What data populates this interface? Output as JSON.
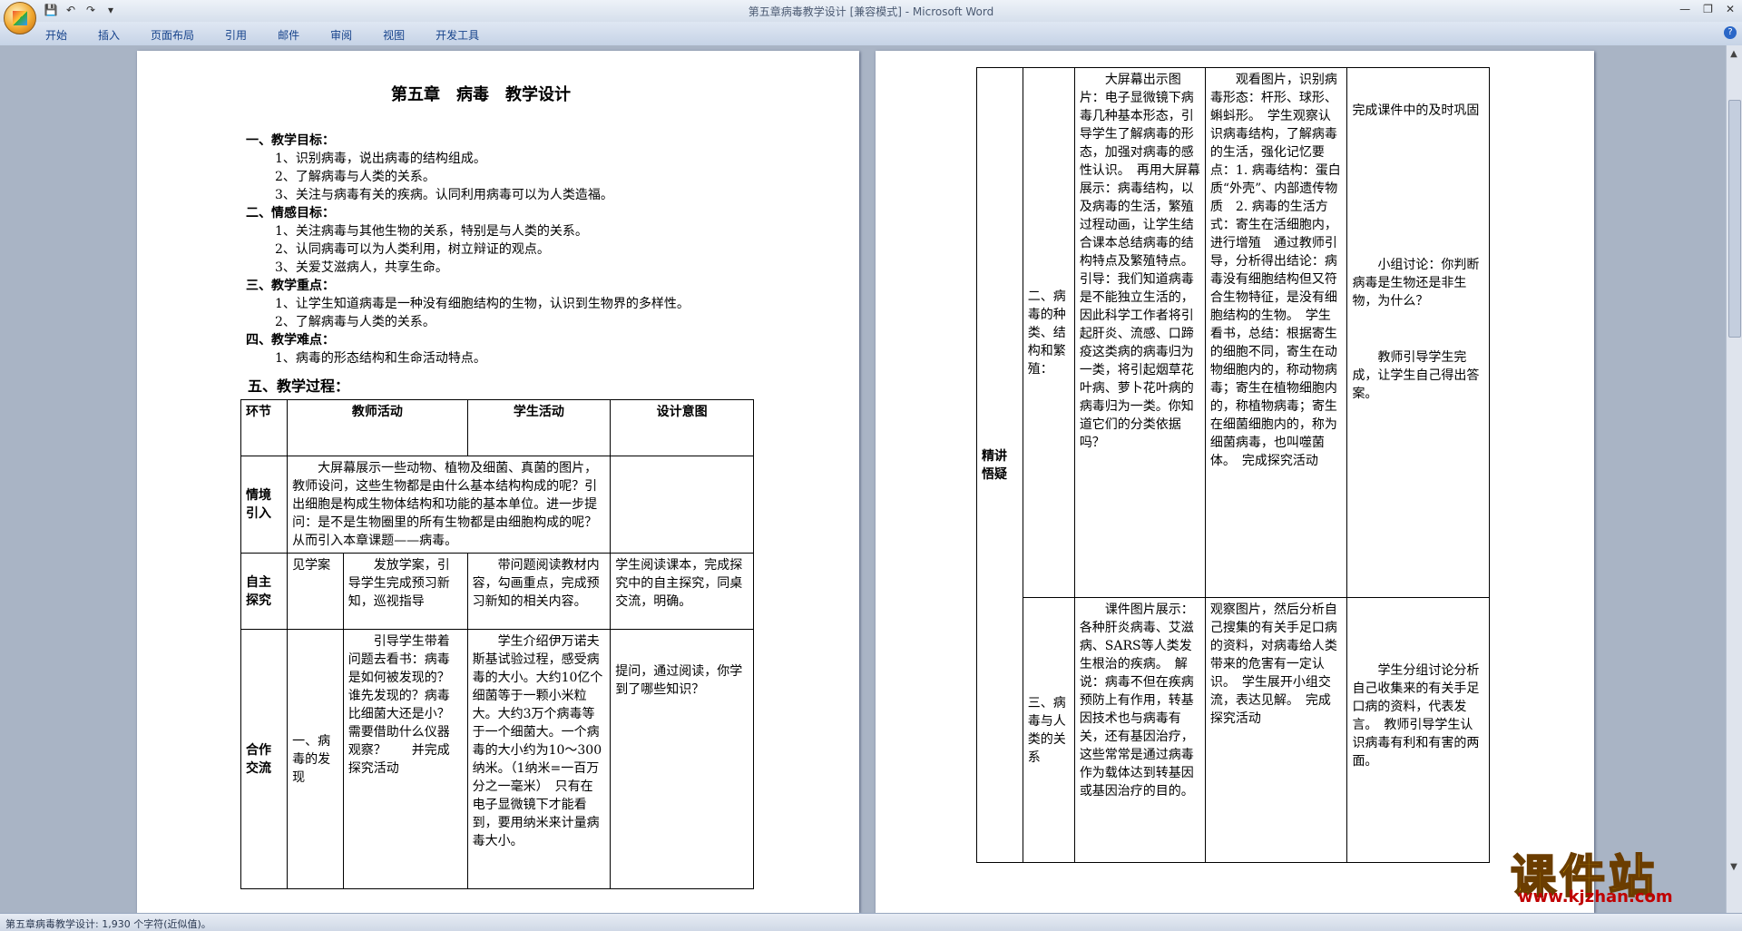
{
  "window": {
    "title": "第五章病毒教学设计 [兼容模式] - Microsoft Word"
  },
  "ribbon": {
    "tabs": [
      "开始",
      "插入",
      "页面布局",
      "引用",
      "邮件",
      "审阅",
      "视图",
      "开发工具"
    ]
  },
  "status": {
    "text": "第五章病毒教学设计: 1,930 个字符(近似值)。"
  },
  "logo": {
    "name": "课件站",
    "url": "www.kjzhan.com"
  },
  "doc": {
    "title": "第五章　病毒　教学设计",
    "s1": "一、教学目标：",
    "s1_1": "1、识别病毒，说出病毒的结构组成。",
    "s1_2": "2、了解病毒与人类的关系。",
    "s1_3": "3、关注与病毒有关的疾病。认同利用病毒可以为人类造福。",
    "s2": "二、情感目标：",
    "s2_1": "1、关注病毒与其他生物的关系，特别是与人类的关系。",
    "s2_2": "2、认同病毒可以为人类利用，树立辩证的观点。",
    "s2_3": "3、关爱艾滋病人，共享生命。",
    "s3": "三、教学重点：",
    "s3_1": "1、让学生知道病毒是一种没有细胞结构的生物，认识到生物界的多样性。",
    "s3_2": "2、了解病毒与人类的关系。",
    "s4": "四、教学难点：",
    "s4_1": "1、病毒的形态结构和生命活动特点。",
    "s5": "五、教学过程：",
    "t1": {
      "h_stage": "环节",
      "h_teacher": "教师活动",
      "h_student": "学生活动",
      "h_intent": "设计意图",
      "r1_stage": "情境引入",
      "r1_teacher": "大屏幕展示一些动物、植物及细菌、真菌的图片，教师设问，这些生物都是由什么基本结构构成的呢？引出细胞是构成生物体结构和功能的基本单位。进一步提问：是不是生物圈里的所有生物都是由细胞构成的呢？从而引入本章课题——病毒。",
      "r2_stage": "自主探究",
      "r2_sub": "见学案",
      "r2_teacher": "发放学案，引导学生完成预习新知，巡视指导",
      "r2_student": "带问题阅读教材内容，勾画重点，完成预习新知的相关内容。",
      "r2_intent": "学生阅读课本，完成探究中的自主探究，同桌交流，明确。",
      "r3_stage": "合作交流",
      "r3_sub": "一、病毒的发现",
      "r3_teacher": "引导学生带着问题去看书：病毒是如何被发现的？谁先发现的？病毒比细菌大还是小？需要借助什么仪器观察？　　并完成探究活动",
      "r3_student": "学生介绍伊万诺夫斯基试验过程，感受病毒的大小。大约10亿个细菌等于一颗小米粒大。大约3万个病毒等于一个细菌大。一个病毒的大小约为10～300纳米。（1纳米=一百万分之一毫米）　只有在电子显微镜下才能看到，要用纳米来计量病毒大小。",
      "r3_intent": "提问，通过阅读，你学到了哪些知识？"
    },
    "t2": {
      "stage": "精讲悟疑",
      "r1_sub": "二、病毒的种类、结构和繁殖：",
      "r1_teacher": "大屏幕出示图片：电子显微镜下病毒几种基本形态，引导学生了解病毒的形态，加强对病毒的感性认识。　再用大屏幕展示：病毒结构，以及病毒的生活，繁殖过程动画，让学生结合课本总结病毒的结构特点及繁殖特点。　引导：我们知道病毒是不能独立生活的，因此科学工作者将引起肝炎、流感、口蹄疫这类病的病毒归为一类，将引起烟草花叶病、萝卜花叶病的病毒归为一类。你知道它们的分类依据吗？",
      "r1_student": "观看图片，识别病毒形态：杆形、球形、蝌蚪形。　学生观察认识病毒结构，了解病毒的生活，强化记忆要点：1. 病毒结构：蛋白质“外壳”、内部遗传物质　2. 病毒的生活方式：寄生在活细胞内，进行增殖　通过教师引导，分析得出结论：病毒没有细胞结构但又符合生物特征，是没有细胞结构的生物。　学生看书，总结：根据寄生的细胞不同，寄生在动物细胞内的，称动物病毒；寄生在植物细胞内的，称植物病毒；寄生在细菌细胞内的，称为细菌病毒，也叫噬菌体。　完成探究活动",
      "r1_intent_a": "完成课件中的及时巩固",
      "r1_intent_b": "小组讨论：你判断病毒是生物还是非生物，为什么？",
      "r1_intent_c": "教师引导学生完成，让学生自己得出答案。",
      "r2_sub": "三、病毒与人类的关系",
      "r2_teacher": "课件图片展示：各种肝炎病毒、艾滋病、SARS等人类发生根治的疾病。　解说：病毒不但在疾病预防上有作用，转基因技术也与病毒有关，还有基因治疗，这些常常是通过病毒作为载体达到转基因或基因治疗的目的。",
      "r2_student": "观察图片，然后分析自己搜集的有关手足口病的资料，对病毒给人类带来的危害有一定认识。　学生展开小组交流，表达见解。　完成探究活动",
      "r2_intent": "学生分组讨论分析自己收集来的有关手足口病的资料，代表发言。　教师引导学生认识病毒有利和有害的两面。"
    }
  }
}
